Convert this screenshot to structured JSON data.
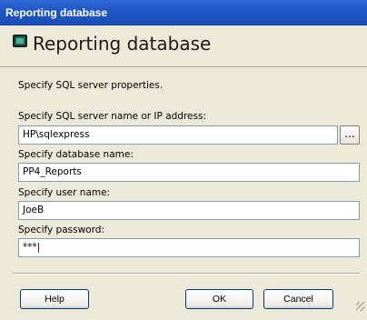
{
  "window": {
    "title": "Reporting database"
  },
  "header": {
    "title": "Reporting database",
    "icon": "database-icon"
  },
  "intro": "Specify SQL server properties.",
  "fields": {
    "server": {
      "label": "Specify SQL server name or IP address:",
      "value": "HP\\sqlexpress"
    },
    "database": {
      "label": "Specify database name:",
      "value": "PP4_Reports"
    },
    "user": {
      "label": "Specify user name:",
      "value": "JoeB"
    },
    "password": {
      "label": "Specify password:",
      "value": "***|"
    }
  },
  "browse_label": "...",
  "buttons": {
    "help": "Help",
    "ok": "OK",
    "cancel": "Cancel"
  },
  "colors": {
    "titlebar": "#1f56c4",
    "background": "#ece9d8",
    "field_border": "#7f9db9"
  }
}
